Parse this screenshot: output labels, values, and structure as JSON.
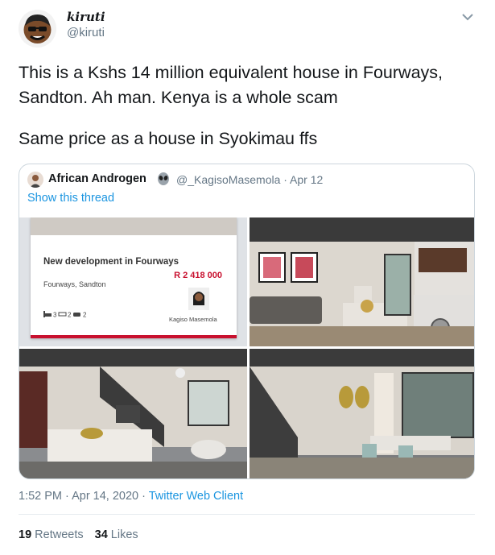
{
  "author": {
    "display_name": "kiruti",
    "handle": "@kiruti"
  },
  "tweet": {
    "paragraphs": [
      "This is a Kshs 14 million equivalent house in Fourways, Sandton. Ah man. Kenya is a whole scam",
      "Same price as a house in Syokimau ffs"
    ]
  },
  "quoted": {
    "display_name": "African Androgen",
    "handle_date": "@_KagisoMasemola · Apr 12",
    "show_thread": "Show this thread",
    "listing": {
      "title": "New development in Fourways",
      "price": "R 2 418 000",
      "location": "Fourways, Sandton",
      "features": "3  2  2",
      "agent": "Kagiso Masemola"
    }
  },
  "meta": {
    "time": "1:52 PM · Apr 14, 2020 · ",
    "client": "Twitter Web Client"
  },
  "stats": {
    "retweets": "19",
    "retweets_label": "Retweets",
    "likes": "34",
    "likes_label": "Likes"
  },
  "icons": [
    "avatar-emoji",
    "chevron-down-icon",
    "alien-icon",
    "bed-icon",
    "bath-icon",
    "car-icon"
  ],
  "colors": {
    "link": "#1b95e0",
    "secondary": "#657786",
    "price": "#c8102e"
  }
}
